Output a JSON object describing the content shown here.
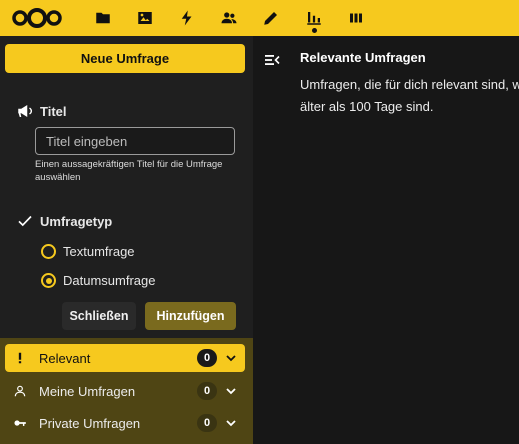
{
  "header": {
    "apps": [
      {
        "icon": "folder-icon",
        "name": "files"
      },
      {
        "icon": "image-icon",
        "name": "photos"
      },
      {
        "icon": "lightning-icon",
        "name": "activity"
      },
      {
        "icon": "contacts-icon",
        "name": "contacts"
      },
      {
        "icon": "pencil-icon",
        "name": "notes"
      },
      {
        "icon": "polls-icon",
        "name": "polls",
        "active": true
      },
      {
        "icon": "deck-icon",
        "name": "deck"
      }
    ],
    "accent": "#f6c91e"
  },
  "sidebar": {
    "new_poll_label": "Neue Umfrage",
    "title_heading": "Titel",
    "title_placeholder": "Titel eingeben",
    "title_hint": "Einen aussagekräftigen Titel für die Umfrage auswählen",
    "type_heading": "Umfragetyp",
    "type_options": [
      {
        "label": "Textumfrage",
        "checked": false
      },
      {
        "label": "Datumsumfrage",
        "checked": true
      }
    ],
    "close_label": "Schließen",
    "add_label": "Hinzufügen",
    "nav": [
      {
        "label": "Relevant",
        "count": "0",
        "icon": "exclamation-icon",
        "active": true
      },
      {
        "label": "Meine Umfragen",
        "count": "0",
        "icon": "user-icon",
        "active": false
      },
      {
        "label": "Private Umfragen",
        "count": "0",
        "icon": "key-icon",
        "active": false
      }
    ]
  },
  "main": {
    "title": "Relevante Umfragen",
    "description_line1": "Umfragen, die für dich relevant sind, we",
    "description_line2": "älter als 100 Tage sind."
  }
}
